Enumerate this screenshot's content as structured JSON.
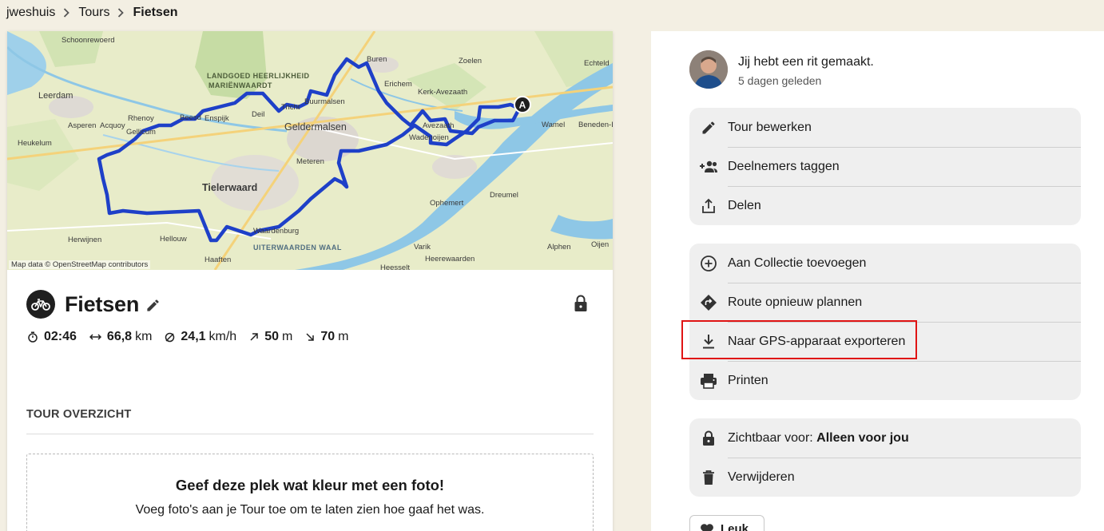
{
  "breadcrumb": {
    "user": "jweshuis",
    "section": "Tours",
    "current": "Fietsen"
  },
  "map": {
    "attribution": "Map data © OpenStreetMap contributors",
    "start_marker": "A",
    "labels": [
      "Schoonrewoerd",
      "LANDGOED HEERLIJKHEID",
      "MARIËNWAARDT",
      "Buren",
      "Zoelen",
      "Echteld",
      "Leerdam",
      "Erichem",
      "Kerk-Avezaath",
      "Rhenoy",
      "Beesd",
      "Enspijk",
      "Deil",
      "Buurmalsen",
      "Tricht",
      "Asperen",
      "Acquoy",
      "Gellicum",
      "Geldermalsen",
      "Avezaath",
      "Wadenoijen",
      "Wamel",
      "Beneden-Leeuwen",
      "Heukelum",
      "Meteren",
      "Tielerwaard",
      "Dreumel",
      "Ophemert",
      "Herwijnen",
      "Hellouw",
      "Waardenburg",
      "Haaften",
      "UITERWAARDEN WAAL",
      "Varik",
      "Heesselt",
      "Heerewaarden",
      "Alphen",
      "Oijen"
    ]
  },
  "tour": {
    "sport": "bike-icon",
    "title": "Fietsen",
    "stats": {
      "duration": "02:46",
      "distance": "66,8",
      "distance_unit": "km",
      "speed": "24,1",
      "speed_unit": "km/h",
      "ascent": "50",
      "ascent_unit": "m",
      "descent": "70",
      "descent_unit": "m"
    }
  },
  "overview": {
    "section_title": "TOUR OVERZICHT",
    "photo_title": "Geef deze plek wat kleur met een foto!",
    "photo_subtitle": "Voeg foto's aan je Tour toe om te laten zien hoe gaaf het was."
  },
  "activity": {
    "title": "Jij hebt een rit gemaakt.",
    "time": "5 dagen geleden"
  },
  "menu1": [
    {
      "label": "Tour bewerken",
      "icon": "pencil-icon"
    },
    {
      "label": "Deelnemers taggen",
      "icon": "people-add-icon"
    },
    {
      "label": "Delen",
      "icon": "share-icon"
    }
  ],
  "menu2": [
    {
      "label": "Aan Collectie toevoegen",
      "icon": "plus-circle-icon"
    },
    {
      "label": "Route opnieuw plannen",
      "icon": "route-icon"
    },
    {
      "label": "Naar GPS-apparaat exporteren",
      "icon": "download-icon"
    },
    {
      "label": "Printen",
      "icon": "printer-icon"
    }
  ],
  "menu3": {
    "visibility_prefix": "Zichtbaar voor: ",
    "visibility_value": "Alleen voor jou",
    "delete_label": "Verwijderen"
  },
  "like_label": "Leuk",
  "colors": {
    "route": "#1e40c8",
    "highlight": "#e01414",
    "water": "#8ec7e6"
  }
}
